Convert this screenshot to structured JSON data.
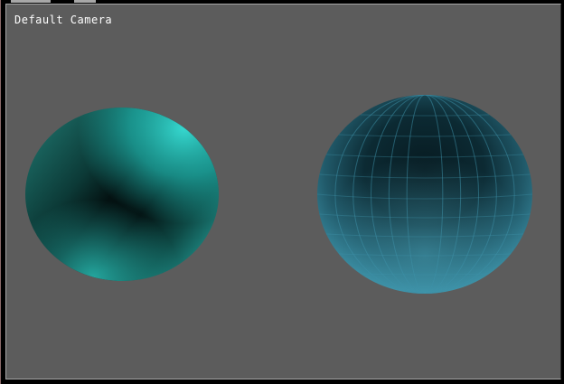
{
  "viewport": {
    "camera_label": "Default Camera",
    "background_color": "#5c5c5c"
  },
  "objects": [
    {
      "name": "smooth-shaded-sphere",
      "shading": "smooth",
      "color": "#2ab8b0"
    },
    {
      "name": "flat-shaded-sphere",
      "shading": "flat",
      "color": "#3e93a8"
    }
  ]
}
